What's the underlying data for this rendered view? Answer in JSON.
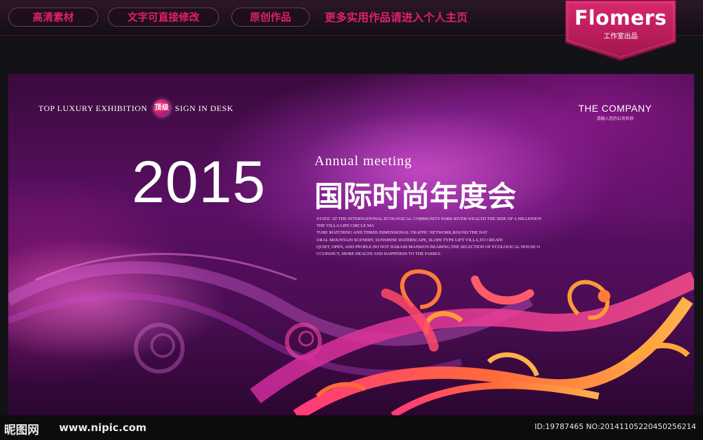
{
  "header": {
    "tags": [
      "高清素材",
      "文字可直接修改",
      "原创作品"
    ],
    "promo": "更多实用作品请进入个人主页",
    "brand": {
      "name": "Flomers",
      "sub": "工作室出品",
      "color": "#c41c5e"
    }
  },
  "banner": {
    "top_left": {
      "before": "Top luxury exhibition",
      "badge": "顶级",
      "after": "Sign in desk"
    },
    "company": {
      "name": "THE COMPANY",
      "sub": "请输入您的公司名称"
    },
    "year": "2015",
    "annual": "Annual meeting",
    "cn_title": "国际时尚年度会",
    "description": [
      "STATIC AT THE INTERNATIONAL ECOLOGICAL COMMUNITY PARK RIVER WEALTH THE SIDE OF A HILLENJOY",
      "THE VILLA LIFE CIRCLE MA",
      "TURE MATCHING AND THREE-DIMENSIONAL TRAFFIC NETWORK,ROUND THE NAT",
      "URAL MOUNTAIN SCENERY, SUNSHINE WATERSCAPE, SLOPE TYPE LIFT VILLA,TO CREATE",
      "QUIET, OPEN, AND PEOPLE DO NOT HARASS MANSION BEARING,THE SELECTION OF ECOLOGICAL HOUSE O",
      "CCUPANCY, MORE HEALTH AND HAPPINESS TO THE FAMILY."
    ],
    "colors": {
      "bg_dark": "#2b0630",
      "bg_mid": "#5a1063",
      "accent_pink": "#e0206e",
      "swirl_orange": "#ff8a2a"
    }
  },
  "footer": {
    "logo": "昵图网",
    "url": "www.nipic.com",
    "id": "ID:19787465 NO:20141105220450256214"
  }
}
